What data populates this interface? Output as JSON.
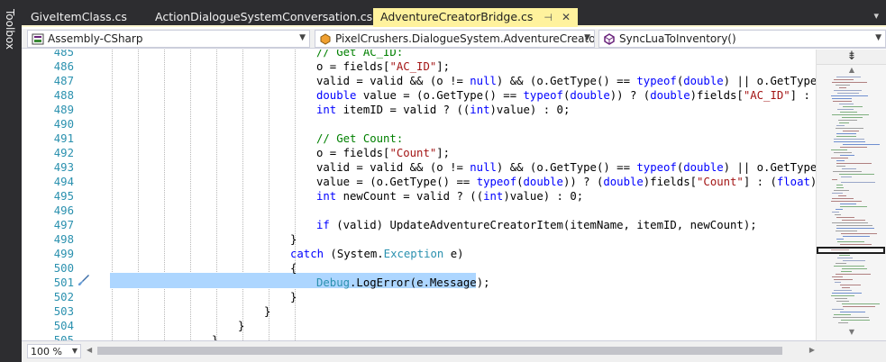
{
  "toolbox": {
    "label": "Toolbox"
  },
  "tabs": [
    {
      "label": "GiveItemClass.cs",
      "active": false
    },
    {
      "label": "ActionDialogueSystemConversation.cs",
      "active": false
    },
    {
      "label": "AdventureCreatorBridge.cs",
      "active": true
    }
  ],
  "navbar": {
    "project": "Assembly-CSharp",
    "type": "PixelCrushers.DialogueSystem.AdventureCreatorSupp",
    "member": "SyncLuaToInventory()"
  },
  "zoom": "100 %",
  "code_lines": [
    {
      "num": "485",
      "indent": 1,
      "tokens": [
        {
          "c": "cm",
          "t": "// Get AC_ID:"
        }
      ]
    },
    {
      "num": "486",
      "indent": 1,
      "tokens": [
        {
          "c": "pl",
          "t": "o = fields["
        },
        {
          "c": "str",
          "t": "\"AC_ID\""
        },
        {
          "c": "pl",
          "t": "];"
        }
      ]
    },
    {
      "num": "487",
      "indent": 1,
      "tokens": [
        {
          "c": "pl",
          "t": "valid = valid && (o != "
        },
        {
          "c": "kw",
          "t": "null"
        },
        {
          "c": "pl",
          "t": ") && (o.GetType() == "
        },
        {
          "c": "kw",
          "t": "typeof"
        },
        {
          "c": "pl",
          "t": "("
        },
        {
          "c": "kw",
          "t": "double"
        },
        {
          "c": "pl",
          "t": ") || o.GetType() =="
        }
      ]
    },
    {
      "num": "488",
      "indent": 1,
      "tokens": [
        {
          "c": "kw",
          "t": "double"
        },
        {
          "c": "pl",
          "t": " value = (o.GetType() == "
        },
        {
          "c": "kw",
          "t": "typeof"
        },
        {
          "c": "pl",
          "t": "("
        },
        {
          "c": "kw",
          "t": "double"
        },
        {
          "c": "pl",
          "t": ")) ? ("
        },
        {
          "c": "kw",
          "t": "double"
        },
        {
          "c": "pl",
          "t": ")fields["
        },
        {
          "c": "str",
          "t": "\"AC_ID\""
        },
        {
          "c": "pl",
          "t": "] : ("
        },
        {
          "c": "kw",
          "t": "float"
        }
      ]
    },
    {
      "num": "489",
      "indent": 1,
      "tokens": [
        {
          "c": "kw",
          "t": "int"
        },
        {
          "c": "pl",
          "t": " itemID = valid ? (("
        },
        {
          "c": "kw",
          "t": "int"
        },
        {
          "c": "pl",
          "t": ")value) : 0;"
        }
      ]
    },
    {
      "num": "490",
      "indent": 1,
      "tokens": []
    },
    {
      "num": "491",
      "indent": 1,
      "tokens": [
        {
          "c": "cm",
          "t": "// Get Count:"
        }
      ]
    },
    {
      "num": "492",
      "indent": 1,
      "tokens": [
        {
          "c": "pl",
          "t": "o = fields["
        },
        {
          "c": "str",
          "t": "\"Count\""
        },
        {
          "c": "pl",
          "t": "];"
        }
      ]
    },
    {
      "num": "493",
      "indent": 1,
      "tokens": [
        {
          "c": "pl",
          "t": "valid = valid && (o != "
        },
        {
          "c": "kw",
          "t": "null"
        },
        {
          "c": "pl",
          "t": ") && (o.GetType() == "
        },
        {
          "c": "kw",
          "t": "typeof"
        },
        {
          "c": "pl",
          "t": "("
        },
        {
          "c": "kw",
          "t": "double"
        },
        {
          "c": "pl",
          "t": ") || o.GetType() =="
        }
      ]
    },
    {
      "num": "494",
      "indent": 1,
      "tokens": [
        {
          "c": "pl",
          "t": "value = (o.GetType() == "
        },
        {
          "c": "kw",
          "t": "typeof"
        },
        {
          "c": "pl",
          "t": "("
        },
        {
          "c": "kw",
          "t": "double"
        },
        {
          "c": "pl",
          "t": ")) ? ("
        },
        {
          "c": "kw",
          "t": "double"
        },
        {
          "c": "pl",
          "t": ")fields["
        },
        {
          "c": "str",
          "t": "\"Count\""
        },
        {
          "c": "pl",
          "t": "] : ("
        },
        {
          "c": "kw",
          "t": "float"
        },
        {
          "c": "pl",
          "t": ")field"
        }
      ]
    },
    {
      "num": "495",
      "indent": 1,
      "tokens": [
        {
          "c": "kw",
          "t": "int"
        },
        {
          "c": "pl",
          "t": " newCount = valid ? (("
        },
        {
          "c": "kw",
          "t": "int"
        },
        {
          "c": "pl",
          "t": ")value) : 0;"
        }
      ]
    },
    {
      "num": "496",
      "indent": 1,
      "tokens": []
    },
    {
      "num": "497",
      "indent": 1,
      "tokens": [
        {
          "c": "kw",
          "t": "if"
        },
        {
          "c": "pl",
          "t": " (valid) UpdateAdventureCreatorItem(itemName, itemID, newCount);"
        }
      ]
    },
    {
      "num": "498",
      "indent": 0,
      "tokens": [
        {
          "c": "pl",
          "t": "}"
        }
      ]
    },
    {
      "num": "499",
      "indent": 0,
      "tokens": [
        {
          "c": "kw",
          "t": "catch"
        },
        {
          "c": "pl",
          "t": " (System."
        },
        {
          "c": "ty",
          "t": "Exception"
        },
        {
          "c": "pl",
          "t": " e)"
        }
      ]
    },
    {
      "num": "500",
      "indent": 0,
      "tokens": [
        {
          "c": "pl",
          "t": "{"
        }
      ]
    },
    {
      "num": "501",
      "indent": 1,
      "tokens": [
        {
          "c": "ty",
          "t": "Debug"
        },
        {
          "c": "pl",
          "t": ".LogError(e.Message);"
        }
      ]
    },
    {
      "num": "502",
      "indent": 0,
      "tokens": [
        {
          "c": "pl",
          "t": "}"
        }
      ]
    },
    {
      "num": "503",
      "indent": -1,
      "tokens": [
        {
          "c": "pl",
          "t": "}"
        }
      ]
    },
    {
      "num": "504",
      "indent": -2,
      "tokens": [
        {
          "c": "pl",
          "t": "}"
        }
      ]
    },
    {
      "num": "505",
      "indent": -3,
      "tokens": [
        {
          "c": "pl",
          "t": "}"
        }
      ]
    }
  ],
  "syntax_colors": {
    "keyword": "#0000ff",
    "string": "#a31515",
    "comment": "#008000",
    "type": "#2b91af",
    "line_number": "#2b91af",
    "selection": "#add6ff",
    "active_tab": "#fff29d"
  },
  "icons": {
    "navbar_project": "csharp-project-icon",
    "navbar_type": "class-icon",
    "navbar_member": "method-icon",
    "editor_margin": "paintbrush-icon",
    "split": "split-editor-icon"
  }
}
